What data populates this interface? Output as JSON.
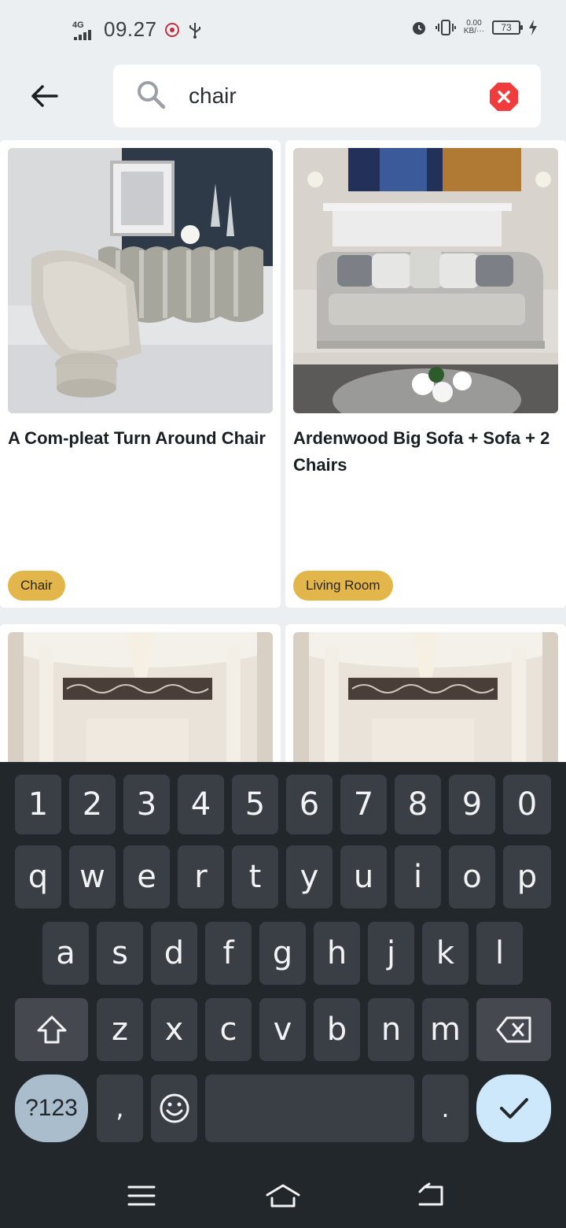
{
  "status_bar": {
    "network": "4G",
    "time": "09.27",
    "speed_value": "0.00",
    "speed_unit": "KB/···",
    "battery": "73"
  },
  "search": {
    "query": "chair",
    "placeholder": ""
  },
  "results": [
    {
      "title": "A Com-pleat Turn Around Chair",
      "tag": "Chair"
    },
    {
      "title": "Ardenwood Big Sofa + Sofa + 2 Chairs",
      "tag": "Living Room"
    },
    {
      "title": "",
      "tag": ""
    },
    {
      "title": "",
      "tag": ""
    }
  ],
  "keyboard": {
    "row_numbers": [
      "1",
      "2",
      "3",
      "4",
      "5",
      "6",
      "7",
      "8",
      "9",
      "0"
    ],
    "row1": [
      "q",
      "w",
      "e",
      "r",
      "t",
      "y",
      "u",
      "i",
      "o",
      "p"
    ],
    "row2": [
      "a",
      "s",
      "d",
      "f",
      "g",
      "h",
      "j",
      "k",
      "l"
    ],
    "row3": [
      "z",
      "x",
      "c",
      "v",
      "b",
      "n",
      "m"
    ],
    "symbols_label": "?123",
    "comma": ",",
    "period": "."
  },
  "colors": {
    "accent_tag": "#e2b64a",
    "clear_button": "#f03c3c",
    "keyboard_bg": "#22272c"
  }
}
